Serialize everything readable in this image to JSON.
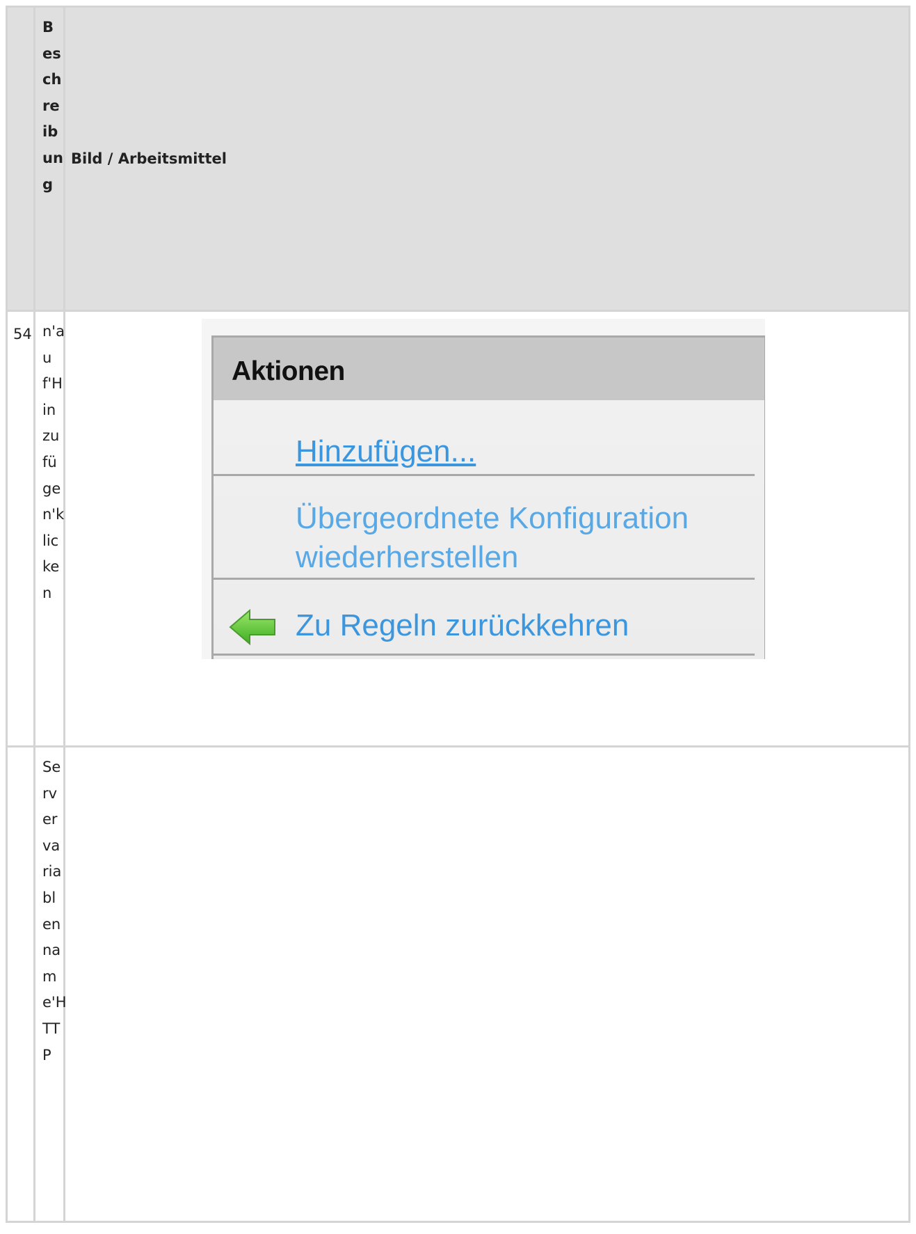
{
  "header": {
    "col_desc": "Beschreibung",
    "col_bild": "Bild / Arbeitsmittel"
  },
  "rows": [
    {
      "number": "54",
      "description": "n'auf'Hinzufügen'klicken",
      "screenshot": {
        "panel_title": "Aktionen",
        "actions": [
          {
            "label": "Hinzufügen...",
            "icon": null
          },
          {
            "label": "Übergeordnete Konfiguration wiederherstellen",
            "line1": "Übergeordnete Konfiguration",
            "line2": "wiederherstellen",
            "icon": null
          },
          {
            "label": "Zu Regeln zurückkehren",
            "icon": "green-back-arrow-icon"
          }
        ]
      }
    },
    {
      "number": "",
      "description": "Servervariablenname'HTTP"
    }
  ]
}
